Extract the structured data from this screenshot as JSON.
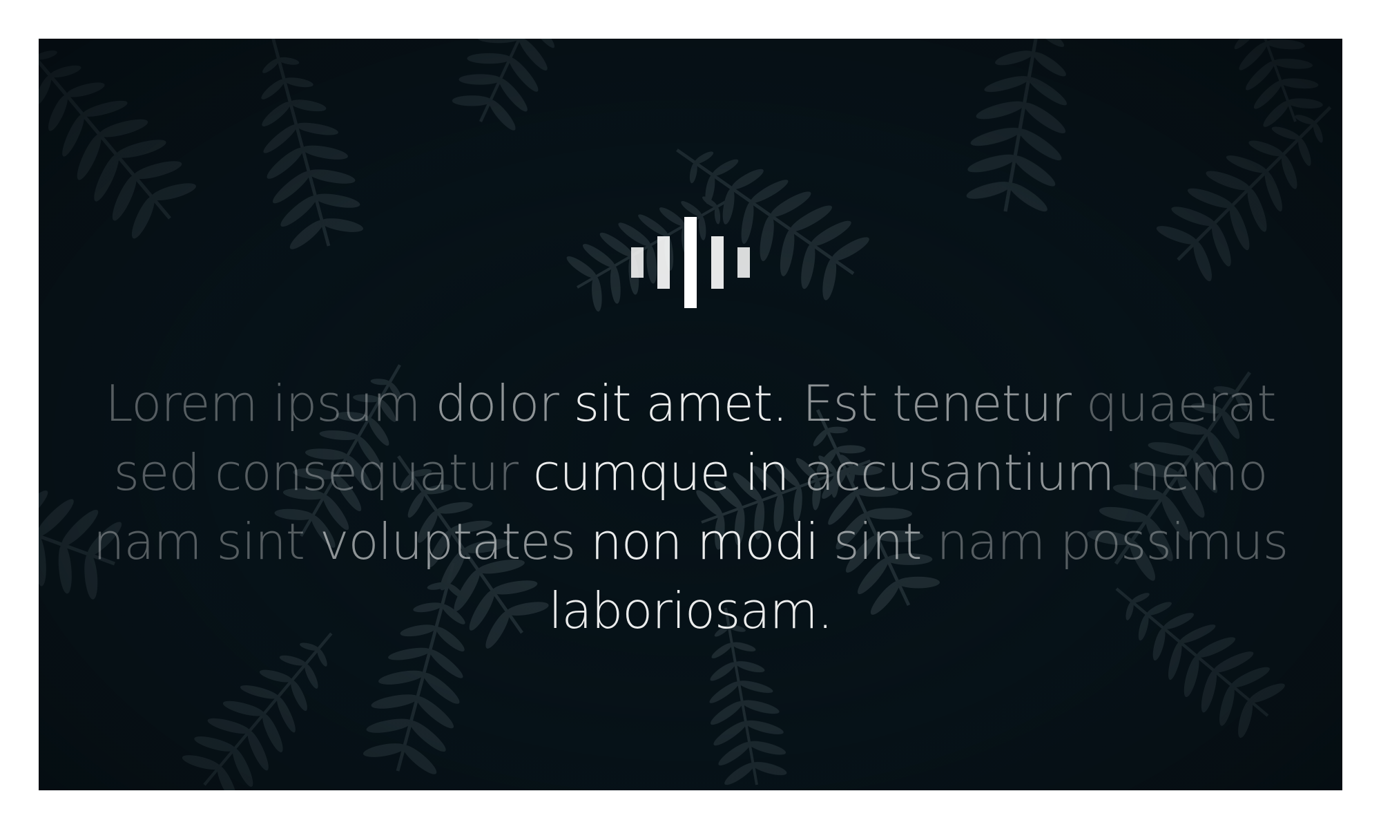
{
  "hero": {
    "logo": {
      "icon": "audio-waveform-icon",
      "bar_color": "#ffffff"
    },
    "background": {
      "description_icon": "fern-leaves-photo",
      "base_color": "#071218"
    },
    "quote_lines": [
      [
        {
          "text": "Lorem ipsum ",
          "tone": "dim"
        },
        {
          "text": "dolor ",
          "tone": "mid"
        },
        {
          "text": "sit amet. ",
          "tone": "bright"
        },
        {
          "text": "Est tenetur ",
          "tone": "mid"
        },
        {
          "text": "quaerat",
          "tone": "dim"
        }
      ],
      [
        {
          "text": "sed consequatur ",
          "tone": "dim"
        },
        {
          "text": "cumque in ",
          "tone": "bright"
        },
        {
          "text": "accusantium ",
          "tone": "mid"
        },
        {
          "text": "nemo",
          "tone": "dim"
        }
      ],
      [
        {
          "text": "nam sint ",
          "tone": "dim"
        },
        {
          "text": "voluptates ",
          "tone": "mid"
        },
        {
          "text": "non modi ",
          "tone": "bright"
        },
        {
          "text": "sint ",
          "tone": "mid"
        },
        {
          "text": "nam possimus",
          "tone": "dim"
        }
      ],
      [
        {
          "text": "laboriosam.",
          "tone": "bright"
        }
      ]
    ]
  }
}
